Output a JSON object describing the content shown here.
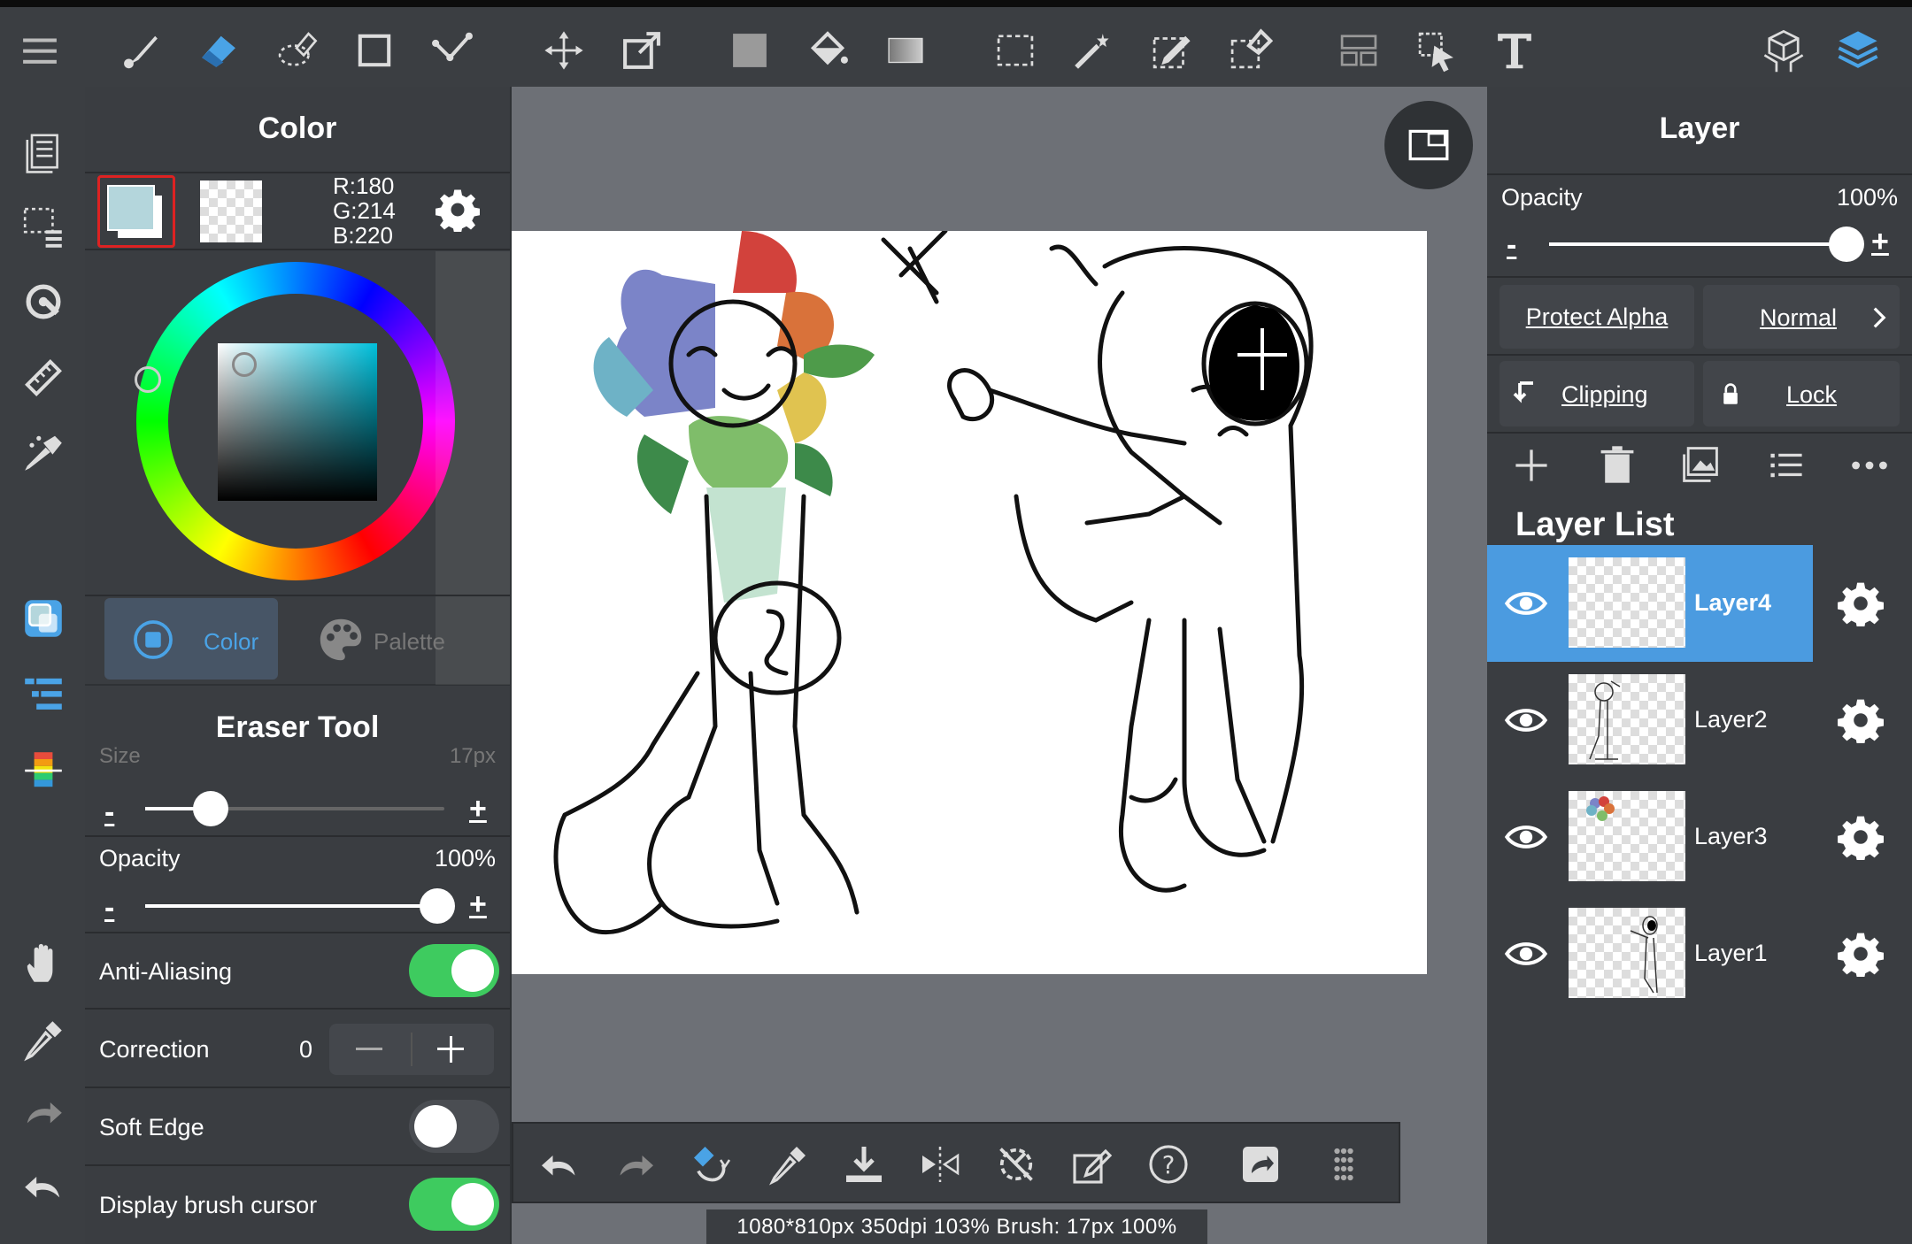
{
  "color_panel": {
    "title": "Color",
    "r": "R:180",
    "g": "G:214",
    "b": "B:220",
    "tab_color": "Color",
    "tab_palette": "Palette",
    "current_color": "#b4d6dc"
  },
  "tool_panel": {
    "title": "Eraser Tool",
    "size_label": "Size",
    "size_value": "17px",
    "size_fraction": 0.22,
    "opacity_label": "Opacity",
    "opacity_value": "100%",
    "opacity_fraction": 1.0,
    "minus": "-",
    "plus": "+",
    "anti_aliasing_label": "Anti-Aliasing",
    "anti_aliasing": true,
    "correction_label": "Correction",
    "correction_value": "0",
    "soft_edge_label": "Soft Edge",
    "soft_edge": false,
    "display_cursor_label": "Display brush cursor",
    "display_cursor": true
  },
  "layer_panel": {
    "title": "Layer",
    "opacity_label": "Opacity",
    "opacity_value": "100%",
    "opacity_fraction": 1.0,
    "minus": "-",
    "plus": "+",
    "protect_alpha": "Protect Alpha",
    "blend_mode": "Normal",
    "clipping": "Clipping",
    "lock": "Lock",
    "list_title": "Layer List",
    "layers": [
      {
        "name": "Layer4",
        "selected": true
      },
      {
        "name": "Layer2",
        "selected": false
      },
      {
        "name": "Layer3",
        "selected": false
      },
      {
        "name": "Layer1",
        "selected": false
      }
    ]
  },
  "status_bar": "1080*810px 350dpi 103% Brush: 17px 100%",
  "colors": {
    "accent_blue": "#4aa3e6",
    "toggle_green": "#3ecb5f",
    "selected_layer": "#4b9be0"
  }
}
